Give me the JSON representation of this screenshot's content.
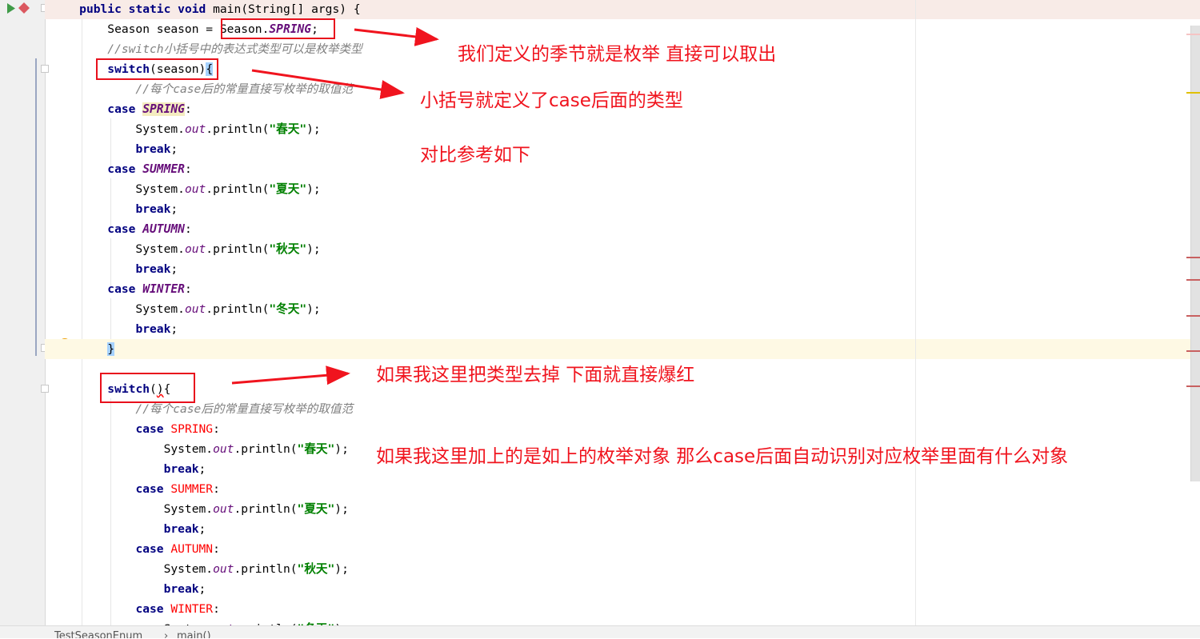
{
  "editor": {
    "lines": [
      {
        "hl": "pink",
        "segs": [
          [
            "    ",
            ""
          ],
          [
            "public static void ",
            "kw"
          ],
          [
            "main(String[] args) {",
            ""
          ]
        ]
      },
      {
        "segs": [
          [
            "        Season season = Season.",
            ""
          ],
          [
            "SPRING",
            "it"
          ],
          [
            ";",
            ""
          ]
        ]
      },
      {
        "segs": [
          [
            "        //switch小括号中的表达式类型可以是枚举类型",
            "cm"
          ]
        ]
      },
      {
        "segs": [
          [
            "        ",
            ""
          ],
          [
            "switch",
            "kw"
          ],
          [
            "(season)",
            ""
          ],
          [
            "{",
            "brace"
          ]
        ]
      },
      {
        "segs": [
          [
            "            //每个case后的常量直接写枚举的取值范",
            "cm"
          ]
        ]
      },
      {
        "segs": [
          [
            "        ",
            ""
          ],
          [
            "case ",
            "kw"
          ],
          [
            "SPRING",
            "it mark"
          ],
          [
            ":",
            ""
          ]
        ]
      },
      {
        "segs": [
          [
            "            System.",
            ""
          ],
          [
            "out",
            "ito"
          ],
          [
            ".println(",
            ""
          ],
          [
            "\"春天\"",
            "str"
          ],
          [
            ");",
            ""
          ]
        ]
      },
      {
        "segs": [
          [
            "            ",
            ""
          ],
          [
            "break",
            "kw"
          ],
          [
            ";",
            ""
          ]
        ]
      },
      {
        "segs": [
          [
            "        ",
            ""
          ],
          [
            "case ",
            "kw"
          ],
          [
            "SUMMER",
            "it"
          ],
          [
            ":",
            ""
          ]
        ]
      },
      {
        "segs": [
          [
            "            System.",
            ""
          ],
          [
            "out",
            "ito"
          ],
          [
            ".println(",
            ""
          ],
          [
            "\"夏天\"",
            "str"
          ],
          [
            ");",
            ""
          ]
        ]
      },
      {
        "segs": [
          [
            "            ",
            ""
          ],
          [
            "break",
            "kw"
          ],
          [
            ";",
            ""
          ]
        ]
      },
      {
        "segs": [
          [
            "        ",
            ""
          ],
          [
            "case ",
            "kw"
          ],
          [
            "AUTUMN",
            "it"
          ],
          [
            ":",
            ""
          ]
        ]
      },
      {
        "segs": [
          [
            "            System.",
            ""
          ],
          [
            "out",
            "ito"
          ],
          [
            ".println(",
            ""
          ],
          [
            "\"秋天\"",
            "str"
          ],
          [
            ");",
            ""
          ]
        ]
      },
      {
        "segs": [
          [
            "            ",
            ""
          ],
          [
            "break",
            "kw"
          ],
          [
            ";",
            ""
          ]
        ]
      },
      {
        "segs": [
          [
            "        ",
            ""
          ],
          [
            "case ",
            "kw"
          ],
          [
            "WINTER",
            "it"
          ],
          [
            ":",
            ""
          ]
        ]
      },
      {
        "segs": [
          [
            "            System.",
            ""
          ],
          [
            "out",
            "ito"
          ],
          [
            ".println(",
            ""
          ],
          [
            "\"冬天\"",
            "str"
          ],
          [
            ");",
            ""
          ]
        ]
      },
      {
        "segs": [
          [
            "            ",
            ""
          ],
          [
            "break",
            "kw"
          ],
          [
            ";",
            ""
          ]
        ]
      },
      {
        "hl": "yellow",
        "segs": [
          [
            "        ",
            ""
          ],
          [
            "}",
            "brace"
          ]
        ]
      },
      {
        "segs": [
          [
            "",
            ""
          ]
        ]
      },
      {
        "segs": [
          [
            "        ",
            ""
          ],
          [
            "switch",
            "kw"
          ],
          [
            "(",
            ""
          ],
          [
            ")",
            "squig"
          ],
          [
            "{",
            ""
          ]
        ]
      },
      {
        "segs": [
          [
            "            //每个case后的常量直接写枚举的取值范",
            "cm"
          ]
        ]
      },
      {
        "segs": [
          [
            "            ",
            ""
          ],
          [
            "case ",
            "kw"
          ],
          [
            "SPRING",
            "err"
          ],
          [
            ":",
            ""
          ]
        ]
      },
      {
        "segs": [
          [
            "                System.",
            ""
          ],
          [
            "out",
            "ito"
          ],
          [
            ".println(",
            ""
          ],
          [
            "\"春天\"",
            "str"
          ],
          [
            ");",
            ""
          ]
        ]
      },
      {
        "segs": [
          [
            "                ",
            ""
          ],
          [
            "break",
            "kw"
          ],
          [
            ";",
            ""
          ]
        ]
      },
      {
        "segs": [
          [
            "            ",
            ""
          ],
          [
            "case ",
            "kw"
          ],
          [
            "SUMMER",
            "err"
          ],
          [
            ":",
            ""
          ]
        ]
      },
      {
        "segs": [
          [
            "                System.",
            ""
          ],
          [
            "out",
            "ito"
          ],
          [
            ".println(",
            ""
          ],
          [
            "\"夏天\"",
            "str"
          ],
          [
            ");",
            ""
          ]
        ]
      },
      {
        "segs": [
          [
            "                ",
            ""
          ],
          [
            "break",
            "kw"
          ],
          [
            ";",
            ""
          ]
        ]
      },
      {
        "segs": [
          [
            "            ",
            ""
          ],
          [
            "case ",
            "kw"
          ],
          [
            "AUTUMN",
            "err"
          ],
          [
            ":",
            ""
          ]
        ]
      },
      {
        "segs": [
          [
            "                System.",
            ""
          ],
          [
            "out",
            "ito"
          ],
          [
            ".println(",
            ""
          ],
          [
            "\"秋天\"",
            "str"
          ],
          [
            ");",
            ""
          ]
        ]
      },
      {
        "segs": [
          [
            "                ",
            ""
          ],
          [
            "break",
            "kw"
          ],
          [
            ";",
            ""
          ]
        ]
      },
      {
        "segs": [
          [
            "            ",
            ""
          ],
          [
            "case ",
            "kw"
          ],
          [
            "WINTER",
            "err"
          ],
          [
            ":",
            ""
          ]
        ]
      },
      {
        "segs": [
          [
            "                System.",
            ""
          ],
          [
            "out",
            "ito"
          ],
          [
            ".println(",
            ""
          ],
          [
            "\"冬天\"",
            "str"
          ],
          [
            ");",
            ""
          ]
        ]
      }
    ]
  },
  "annotations": {
    "note1": "我们定义的季节就是枚举 直接可以取出",
    "note2": "小括号就定义了case后面的类型",
    "note3": "对比参考如下",
    "note4": "如果我这里把类型去掉 下面就直接爆红",
    "note5": "如果我这里加上的是如上的枚举对象  那么case后面自动识别对应枚举里面有什么对象",
    "color": "#f0141e"
  },
  "statusbar": {
    "breadcrumb": [
      "TestSeasonEnum",
      "main()"
    ],
    "separator": "›"
  },
  "icons": {
    "run": "run-icon",
    "breakpoint": "breakpoint-icon",
    "intention": "lightbulb-icon"
  }
}
